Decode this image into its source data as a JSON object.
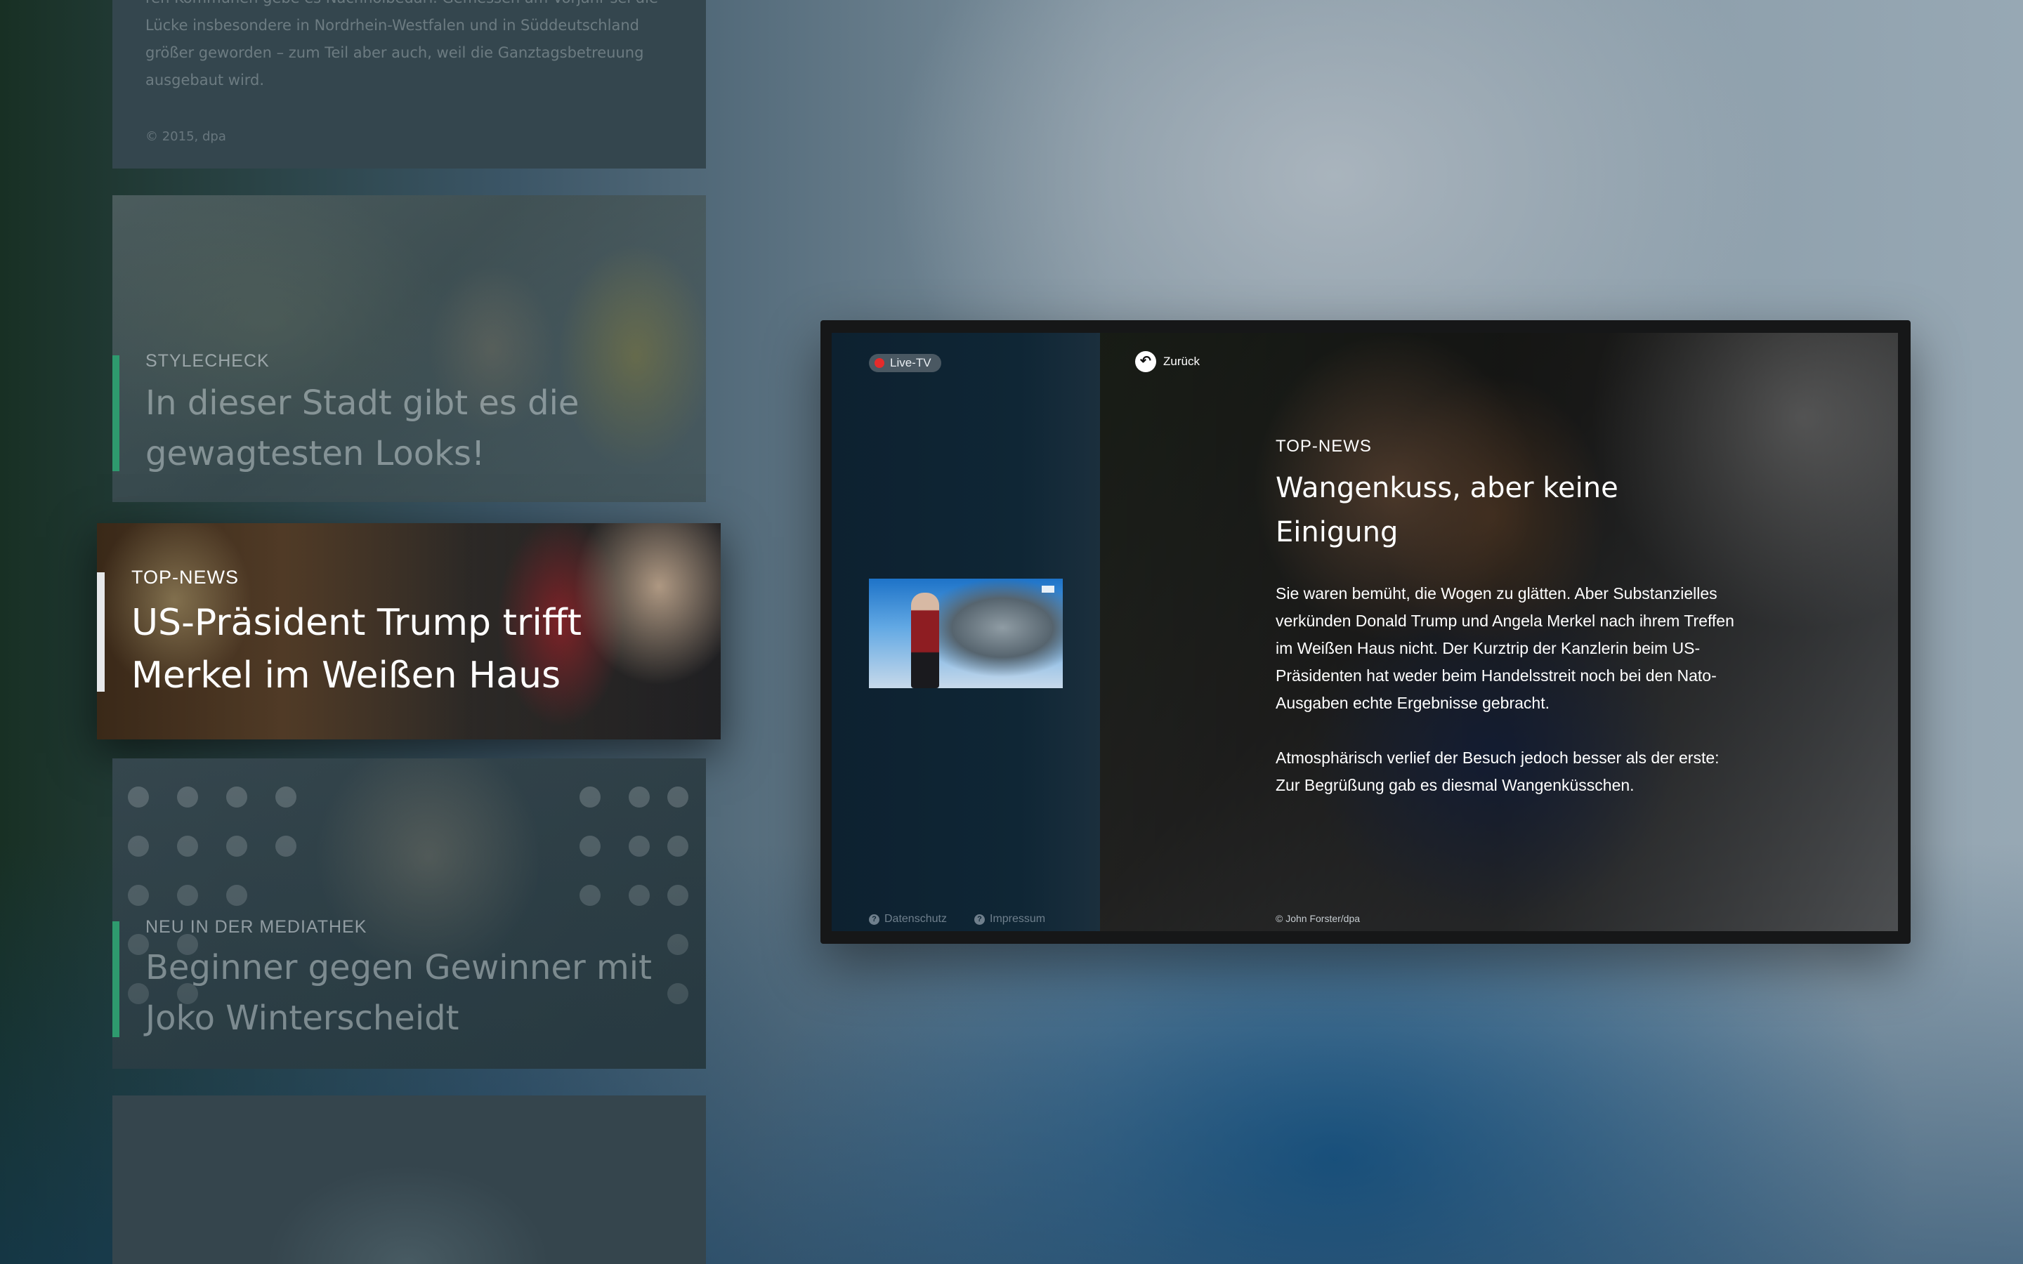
{
  "left_column": {
    "text_card": {
      "body": "ren Kommunen gebe es Nachholbedarf. Gemessen am Vorjahr sei die Lücke insbesondere in Nordrhein-Westfalen und in Süddeutschland größer geworden – zum Teil aber auch, weil die Ganztagsbetreuung ausgebaut wird.",
      "credit": "© 2015, dpa"
    },
    "stylecheck_card": {
      "kicker": "STYLECHECK",
      "headline": "In dieser Stadt gibt es die gewagtesten Looks!"
    },
    "top_news_card": {
      "kicker": "TOP-NEWS",
      "headline": "US-Präsident Trump trifft Merkel im Weißen Haus"
    },
    "mediathek_card": {
      "kicker": "NEU IN DER MEDIATHEK",
      "headline": "Beginner gegen Gewinner mit Joko Winterscheidt"
    }
  },
  "tv": {
    "live_label": "Live-TV",
    "back_label": "Zurück",
    "footer": {
      "privacy_label": "Datenschutz",
      "imprint_label": "Impressum"
    },
    "article": {
      "kicker": "TOP-NEWS",
      "title": "Wangenkuss, aber keine Einigung",
      "paragraph_1": "Sie waren bemüht, die Wogen zu glätten. Aber Substanzielles verkünden Donald Trump und Angela Merkel nach ihrem Treffen im Weißen Haus nicht. Der Kurztrip der Kanzlerin beim US-Präsidenten hat weder beim Handelsstreit noch bei den Nato-Ausgaben echte Ergebnisse gebracht.",
      "paragraph_2": "Atmosphärisch verlief der Besuch jedoch besser als der erste: Zur Begrüßung gab es diesmal Wangenküsschen.",
      "credit": "© John Forster/dpa"
    }
  },
  "colors": {
    "accent_green": "#2e9a6e",
    "live_red": "#e52b2b",
    "panel_navy": "#0f2635"
  },
  "icons": {
    "live": "red-dot-icon",
    "back": "back-arrow-icon",
    "info": "question-circle-icon"
  }
}
